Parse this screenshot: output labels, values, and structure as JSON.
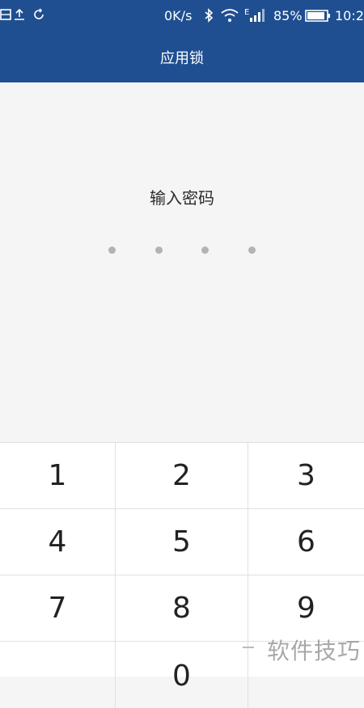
{
  "status_bar": {
    "net_speed": "0K/s",
    "signal_type": "E",
    "battery_percent": "85%",
    "time": "10:2",
    "icons": [
      "gallery-icon",
      "upload-icon",
      "sync-icon",
      "bluetooth-icon",
      "wifi-icon",
      "signal-icon",
      "battery-icon"
    ]
  },
  "app_bar": {
    "title": "应用锁"
  },
  "lock_screen": {
    "prompt": "输入密码",
    "pin_length": 4,
    "entered": 0
  },
  "keypad": {
    "keys": [
      "1",
      "2",
      "3",
      "4",
      "5",
      "6",
      "7",
      "8",
      "9",
      "",
      "0",
      ""
    ]
  },
  "watermark": {
    "text": "软件技巧"
  },
  "colors": {
    "primary": "#1f4f91",
    "background": "#f5f5f5",
    "dot": "#b3b3b3"
  }
}
